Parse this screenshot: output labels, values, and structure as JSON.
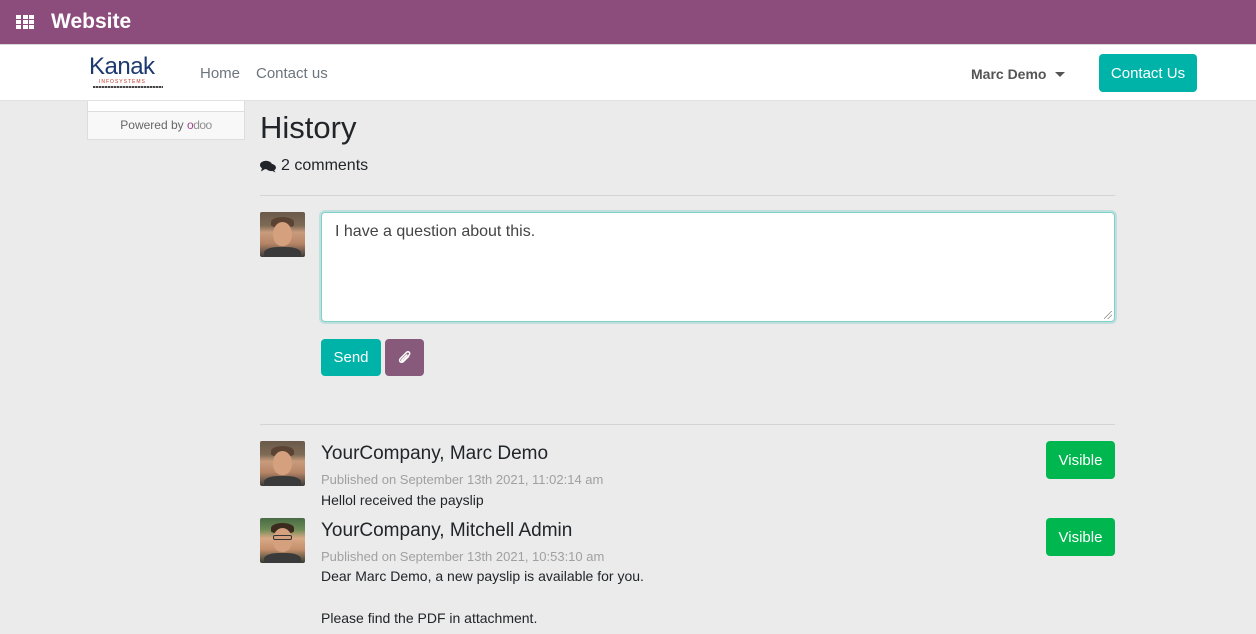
{
  "app": {
    "title": "Website"
  },
  "navbar": {
    "logo": {
      "name": "Kanak",
      "tagline": "INFOSYSTEMS"
    },
    "links": [
      "Home",
      "Contact us"
    ],
    "user": "Marc Demo",
    "cta": "Contact Us"
  },
  "sidebar": {
    "powered_by": "Powered by",
    "brand": "odoo"
  },
  "page": {
    "title": "History",
    "comments_label": "2 comments"
  },
  "composer": {
    "value": "I have a question about this.",
    "send_label": "Send"
  },
  "messages": [
    {
      "author": "YourCompany, Marc Demo",
      "date": "Published on September 13th 2021, 11:02:14 am",
      "body": "Hellol received the payslip",
      "status": "Visible"
    },
    {
      "author": "YourCompany, Mitchell Admin",
      "date": "Published on September 13th 2021, 10:53:10 am",
      "body_lines": [
        "Dear Marc Demo, a new payslip is available for you.",
        "Please find the PDF in attachment."
      ],
      "status": "Visible"
    }
  ],
  "colors": {
    "appbar": "#8c4d7c",
    "primary": "#00b3a8",
    "secondary": "#875a7b",
    "success": "#00b64f"
  }
}
